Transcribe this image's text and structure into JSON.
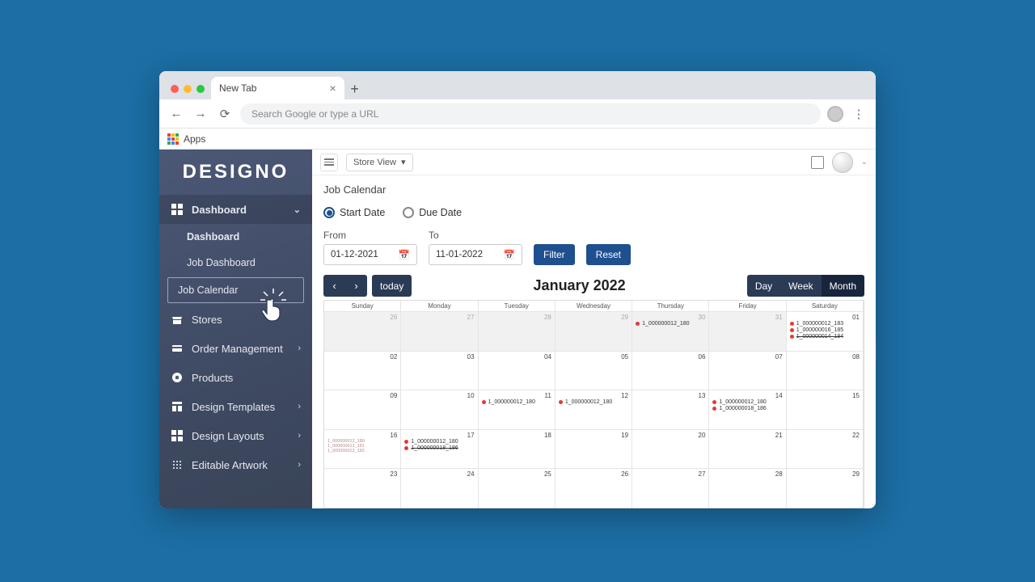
{
  "browser": {
    "tab_title": "New Tab",
    "omnibox_placeholder": "Search Google or type a URL",
    "bookmarks_label": "Apps"
  },
  "brand": "DESIGNO",
  "sidebar": {
    "dashboard_label": "Dashboard",
    "sub": {
      "dashboard": "Dashboard",
      "job_dashboard": "Job Dashboard",
      "job_calendar": "Job Calendar"
    },
    "items": [
      {
        "label": "Stores"
      },
      {
        "label": "Order Management"
      },
      {
        "label": "Products"
      },
      {
        "label": "Design Templates"
      },
      {
        "label": "Design Layouts"
      },
      {
        "label": "Editable Artwork"
      }
    ]
  },
  "appbar": {
    "store_view": "Store View"
  },
  "page": {
    "title": "Job Calendar",
    "radios": {
      "start": "Start Date",
      "due": "Due Date",
      "selected": "start"
    },
    "from_label": "From",
    "to_label": "To",
    "from_value": "01-12-2021",
    "to_value": "11-01-2022",
    "filter": "Filter",
    "reset": "Reset"
  },
  "calendar": {
    "title": "January 2022",
    "today": "today",
    "views": {
      "day": "Day",
      "week": "Week",
      "month": "Month",
      "active": "month"
    },
    "dow": [
      "Sunday",
      "Monday",
      "Tuesday",
      "Wednesday",
      "Thursday",
      "Friday",
      "Saturday"
    ],
    "weeks": [
      [
        {
          "n": "26",
          "out": true
        },
        {
          "n": "27",
          "out": true
        },
        {
          "n": "28",
          "out": true
        },
        {
          "n": "29",
          "out": true
        },
        {
          "n": "30",
          "out": true,
          "events": [
            {
              "t": "1_000000012_180"
            }
          ]
        },
        {
          "n": "31",
          "out": true
        },
        {
          "n": "01",
          "events": [
            {
              "t": "1_000000012_183"
            },
            {
              "t": "1_000000016_185"
            },
            {
              "t": "1_000000014_184",
              "strike": true
            }
          ]
        }
      ],
      [
        {
          "n": "02"
        },
        {
          "n": "03"
        },
        {
          "n": "04"
        },
        {
          "n": "05"
        },
        {
          "n": "06"
        },
        {
          "n": "07"
        },
        {
          "n": "08"
        }
      ],
      [
        {
          "n": "09"
        },
        {
          "n": "10"
        },
        {
          "n": "11",
          "events": [
            {
              "t": "1_000000012_180"
            }
          ]
        },
        {
          "n": "12",
          "events": [
            {
              "t": "1_000000012_180"
            }
          ]
        },
        {
          "n": "13"
        },
        {
          "n": "14",
          "events": [
            {
              "t": "1_000000012_180"
            },
            {
              "t": "1_000000018_186"
            }
          ]
        },
        {
          "n": "15"
        }
      ],
      [
        {
          "n": "16",
          "tiny": [
            "1_000000012_180",
            "1_000000012_181",
            "1_000000012_182"
          ]
        },
        {
          "n": "17",
          "events": [
            {
              "t": "1_000000012_180"
            },
            {
              "t": "1_000000018_186",
              "strike": true
            }
          ]
        },
        {
          "n": "18"
        },
        {
          "n": "19"
        },
        {
          "n": "20"
        },
        {
          "n": "21"
        },
        {
          "n": "22"
        }
      ],
      [
        {
          "n": "23"
        },
        {
          "n": "24"
        },
        {
          "n": "25"
        },
        {
          "n": "26"
        },
        {
          "n": "27"
        },
        {
          "n": "28"
        },
        {
          "n": "29"
        }
      ]
    ]
  }
}
